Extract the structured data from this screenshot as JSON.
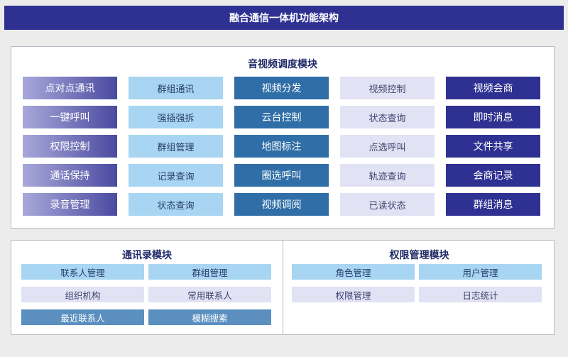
{
  "title": "融合通信一体机功能架构",
  "av_module": {
    "title": "音视频调度模块",
    "columns": [
      [
        "点对点通讯",
        "一键呼叫",
        "权限控制",
        "通话保持",
        "录音管理"
      ],
      [
        "群组通讯",
        "强插强拆",
        "群组管理",
        "记录查询",
        "状态查询"
      ],
      [
        "视频分发",
        "云台控制",
        "地图标注",
        "圈选呼叫",
        "视频调阅"
      ],
      [
        "视频控制",
        "状态查询",
        "点选呼叫",
        "轨迹查询",
        "已读状态"
      ],
      [
        "视频会商",
        "即时消息",
        "文件共享",
        "会商记录",
        "群组消息"
      ]
    ]
  },
  "contacts_module": {
    "title": "通讯录模块",
    "rows": [
      [
        "联系人管理",
        "群组管理"
      ],
      [
        "组织机构",
        "常用联系人"
      ],
      [
        "最近联系人",
        "模糊搜索"
      ]
    ]
  },
  "permission_module": {
    "title": "权限管理模块",
    "rows": [
      [
        "角色管理",
        "用户管理"
      ],
      [
        "权限管理",
        "日志统计"
      ]
    ]
  },
  "colors": {
    "title_bar": "#2e3192",
    "col_gradient": "#4a4aa0",
    "col_light_blue": "#a7d5f2",
    "col_steel_blue": "#2f6ea6",
    "col_pale": "#e1e2f3",
    "col_navy": "#2e3192"
  }
}
